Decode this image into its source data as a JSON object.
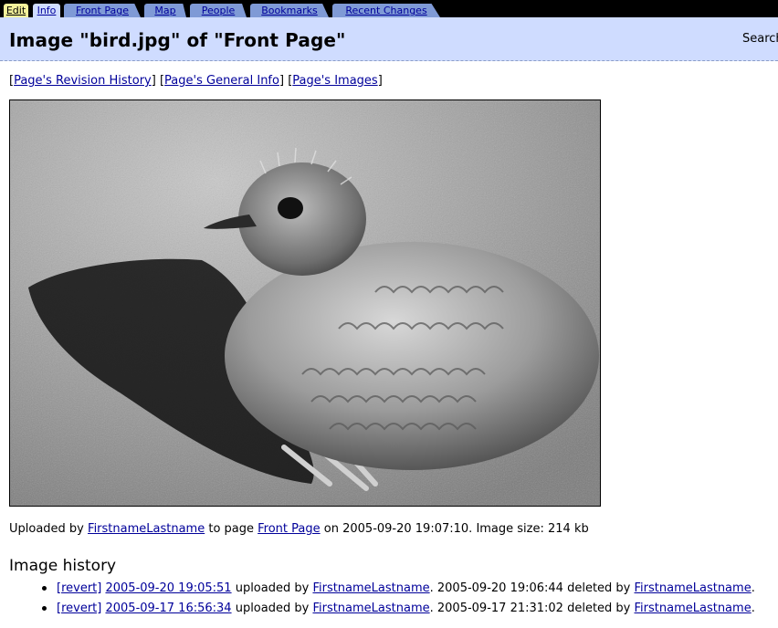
{
  "tabs": {
    "edit": "Edit",
    "info": "Info",
    "front_page": "Front Page",
    "map": "Map",
    "people": "People",
    "bookmarks": "Bookmarks",
    "recent_changes": "Recent Changes"
  },
  "header": {
    "title": "Image \"bird.jpg\" of \"Front Page\"",
    "search_label": "Search"
  },
  "page_links": {
    "revision_history": "Page's Revision History",
    "general_info": "Page's General Info",
    "images": "Page's Images",
    "open": "[",
    "close": "]"
  },
  "upload": {
    "prefix": "Uploaded by",
    "user": "FirstnameLastname",
    "to_page": "to page",
    "page": "Front Page",
    "on_date": "on 2005-09-20 19:07:10. Image size: 214 kb"
  },
  "history": {
    "heading": "Image history",
    "items": [
      {
        "revert": "[revert]",
        "timestamp": "2005-09-20 19:05:51",
        "uploaded_by": "uploaded by",
        "uploader": "FirstnameLastname",
        "deleted": ". 2005-09-20 19:06:44 deleted by",
        "deleter": "FirstnameLastname",
        "end": "."
      },
      {
        "revert": "[revert]",
        "timestamp": "2005-09-17 16:56:34",
        "uploaded_by": "uploaded by",
        "uploader": "FirstnameLastname",
        "deleted": ". 2005-09-17 21:31:02 deleted by",
        "deleter": "FirstnameLastname",
        "end": "."
      }
    ]
  },
  "colors": {
    "header_bg": "#cfdcff",
    "tab_nav": "#7f9ad6",
    "tab_edit": "#f4f19b",
    "link": "#00009a"
  }
}
